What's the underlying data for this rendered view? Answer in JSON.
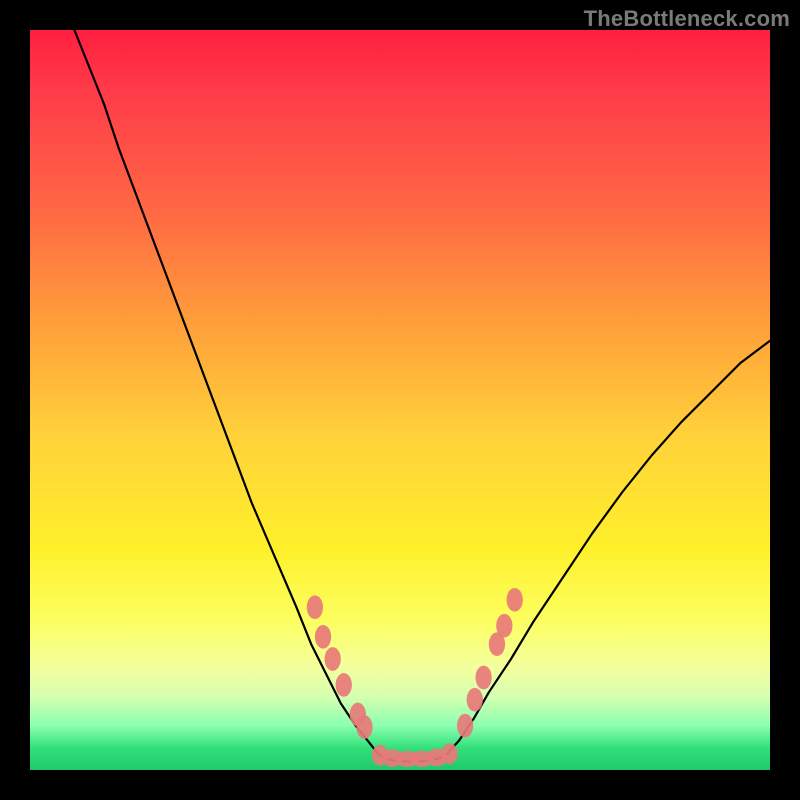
{
  "watermark": "TheBottleneck.com",
  "chart_data": {
    "type": "line",
    "title": "",
    "xlabel": "",
    "ylabel": "",
    "xlim": [
      0,
      100
    ],
    "ylim": [
      0,
      100
    ],
    "grid": false,
    "legend": false,
    "series": [
      {
        "name": "left-curve",
        "x": [
          6,
          8,
          10,
          12,
          15,
          18,
          21,
          24,
          27,
          30,
          33,
          36,
          38,
          40,
          42,
          44,
          46,
          47,
          48
        ],
        "y": [
          100,
          95,
          90,
          84,
          76,
          68,
          60,
          52,
          44,
          36,
          29,
          22,
          17,
          13,
          9,
          6,
          3.5,
          2.2,
          1.5
        ]
      },
      {
        "name": "floor",
        "x": [
          48,
          49,
          50,
          51,
          52,
          53,
          54,
          55,
          56
        ],
        "y": [
          1.5,
          1.3,
          1.2,
          1.15,
          1.15,
          1.2,
          1.3,
          1.5,
          1.8
        ]
      },
      {
        "name": "right-curve",
        "x": [
          56,
          58,
          60,
          62,
          65,
          68,
          72,
          76,
          80,
          84,
          88,
          92,
          96,
          100
        ],
        "y": [
          1.8,
          4,
          7,
          10.5,
          15,
          20,
          26,
          32,
          37.5,
          42.5,
          47,
          51,
          55,
          58
        ]
      }
    ],
    "markers": [
      {
        "name": "left-markers",
        "color": "#e87a7a",
        "points": [
          {
            "x": 38.5,
            "y": 22.0,
            "rx": 1.1,
            "ry": 1.6
          },
          {
            "x": 39.6,
            "y": 18.0,
            "rx": 1.1,
            "ry": 1.6
          },
          {
            "x": 40.9,
            "y": 15.0,
            "rx": 1.1,
            "ry": 1.6
          },
          {
            "x": 42.4,
            "y": 11.5,
            "rx": 1.1,
            "ry": 1.6
          },
          {
            "x": 44.3,
            "y": 7.5,
            "rx": 1.1,
            "ry": 1.6
          },
          {
            "x": 45.2,
            "y": 5.8,
            "rx": 1.1,
            "ry": 1.6
          }
        ]
      },
      {
        "name": "bottom-markers",
        "color": "#e87a7a",
        "points": [
          {
            "x": 47.3,
            "y": 2.0,
            "rx": 1.1,
            "ry": 1.4
          },
          {
            "x": 49.0,
            "y": 1.6,
            "rx": 1.4,
            "ry": 1.2
          },
          {
            "x": 51.0,
            "y": 1.5,
            "rx": 1.6,
            "ry": 1.1
          },
          {
            "x": 53.0,
            "y": 1.5,
            "rx": 1.6,
            "ry": 1.1
          },
          {
            "x": 55.0,
            "y": 1.7,
            "rx": 1.4,
            "ry": 1.2
          },
          {
            "x": 56.7,
            "y": 2.2,
            "rx": 1.1,
            "ry": 1.4
          }
        ]
      },
      {
        "name": "right-markers",
        "color": "#e87a7a",
        "points": [
          {
            "x": 58.8,
            "y": 6.0,
            "rx": 1.1,
            "ry": 1.6
          },
          {
            "x": 60.1,
            "y": 9.5,
            "rx": 1.1,
            "ry": 1.6
          },
          {
            "x": 61.3,
            "y": 12.5,
            "rx": 1.1,
            "ry": 1.6
          },
          {
            "x": 63.1,
            "y": 17.0,
            "rx": 1.1,
            "ry": 1.6
          },
          {
            "x": 64.1,
            "y": 19.5,
            "rx": 1.1,
            "ry": 1.6
          },
          {
            "x": 65.5,
            "y": 23.0,
            "rx": 1.1,
            "ry": 1.6
          }
        ]
      }
    ],
    "colors": {
      "line": "#000000",
      "marker": "#e87a7a",
      "bg_top": "#ff1f3f",
      "bg_bottom": "#1fc96c"
    }
  }
}
